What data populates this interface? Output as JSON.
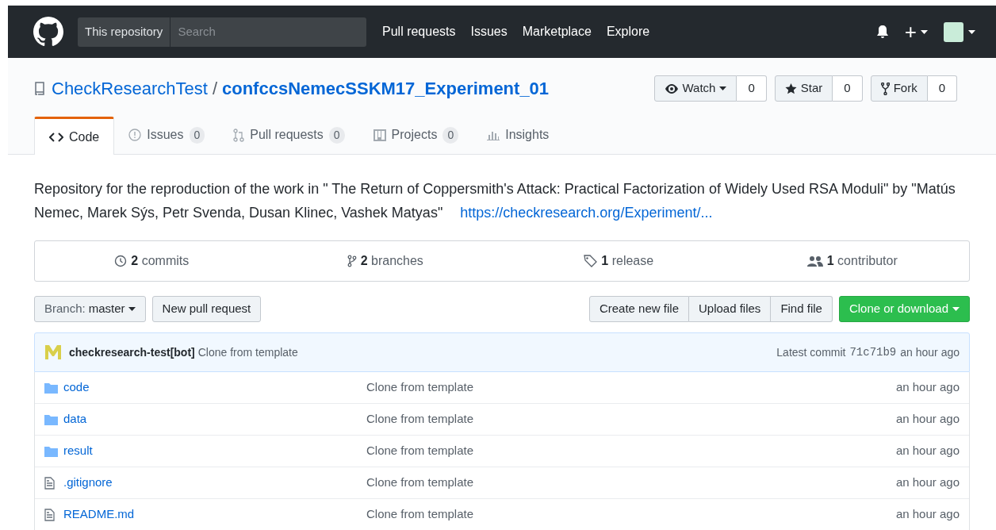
{
  "header": {
    "scope": "This repository",
    "search_placeholder": "Search",
    "nav": [
      "Pull requests",
      "Issues",
      "Marketplace",
      "Explore"
    ],
    "plus": "+"
  },
  "repo": {
    "owner": "CheckResearchTest",
    "separator": "/",
    "name": "confccsNemecSSKM17_Experiment_01",
    "actions": [
      {
        "kind": "watch",
        "label": "Watch",
        "count": "0"
      },
      {
        "kind": "star",
        "label": "Star",
        "count": "0"
      },
      {
        "kind": "fork",
        "label": "Fork",
        "count": "0"
      }
    ]
  },
  "tabs": [
    {
      "kind": "code",
      "label": "Code",
      "selected": true
    },
    {
      "kind": "issues",
      "label": "Issues",
      "counter": "0",
      "selected": false
    },
    {
      "kind": "pulls",
      "label": "Pull requests",
      "counter": "0",
      "selected": false
    },
    {
      "kind": "projects",
      "label": "Projects",
      "counter": "0",
      "selected": false
    },
    {
      "kind": "insights",
      "label": "Insights",
      "selected": false
    }
  ],
  "description": {
    "text": "Repository for the reproduction of the work in \" The Return of Coppersmith's Attack: Practical Factorization of Widely Used RSA Moduli\" by \"Matús Nemec, Marek Sýs, Petr Svenda, Dusan Klinec, Vashek Matyas\"",
    "link": "https://checkresearch.org/Experiment/..."
  },
  "stats": [
    {
      "kind": "commits",
      "count": "2",
      "label": "commits"
    },
    {
      "kind": "branches",
      "count": "2",
      "label": "branches"
    },
    {
      "kind": "releases",
      "count": "1",
      "label": "release"
    },
    {
      "kind": "contributors",
      "count": "1",
      "label": "contributor"
    }
  ],
  "toolbar": {
    "branch_label": "Branch:",
    "branch": "master",
    "new_pr": "New pull request",
    "file_buttons": [
      "Create new file",
      "Upload files",
      "Find file"
    ],
    "clone": "Clone or download"
  },
  "commit": {
    "author": "checkresearch-test[bot]",
    "message": "Clone from template",
    "latest_label": "Latest commit",
    "sha": "71c71b9",
    "age": "an hour ago"
  },
  "files": [
    {
      "kind": "folder",
      "name": "code",
      "message": "Clone from template",
      "age": "an hour ago"
    },
    {
      "kind": "folder",
      "name": "data",
      "message": "Clone from template",
      "age": "an hour ago"
    },
    {
      "kind": "folder",
      "name": "result",
      "message": "Clone from template",
      "age": "an hour ago"
    },
    {
      "kind": "file",
      "name": ".gitignore",
      "message": "Clone from template",
      "age": "an hour ago"
    },
    {
      "kind": "file",
      "name": "README.md",
      "message": "Clone from template",
      "age": "an hour ago"
    }
  ]
}
